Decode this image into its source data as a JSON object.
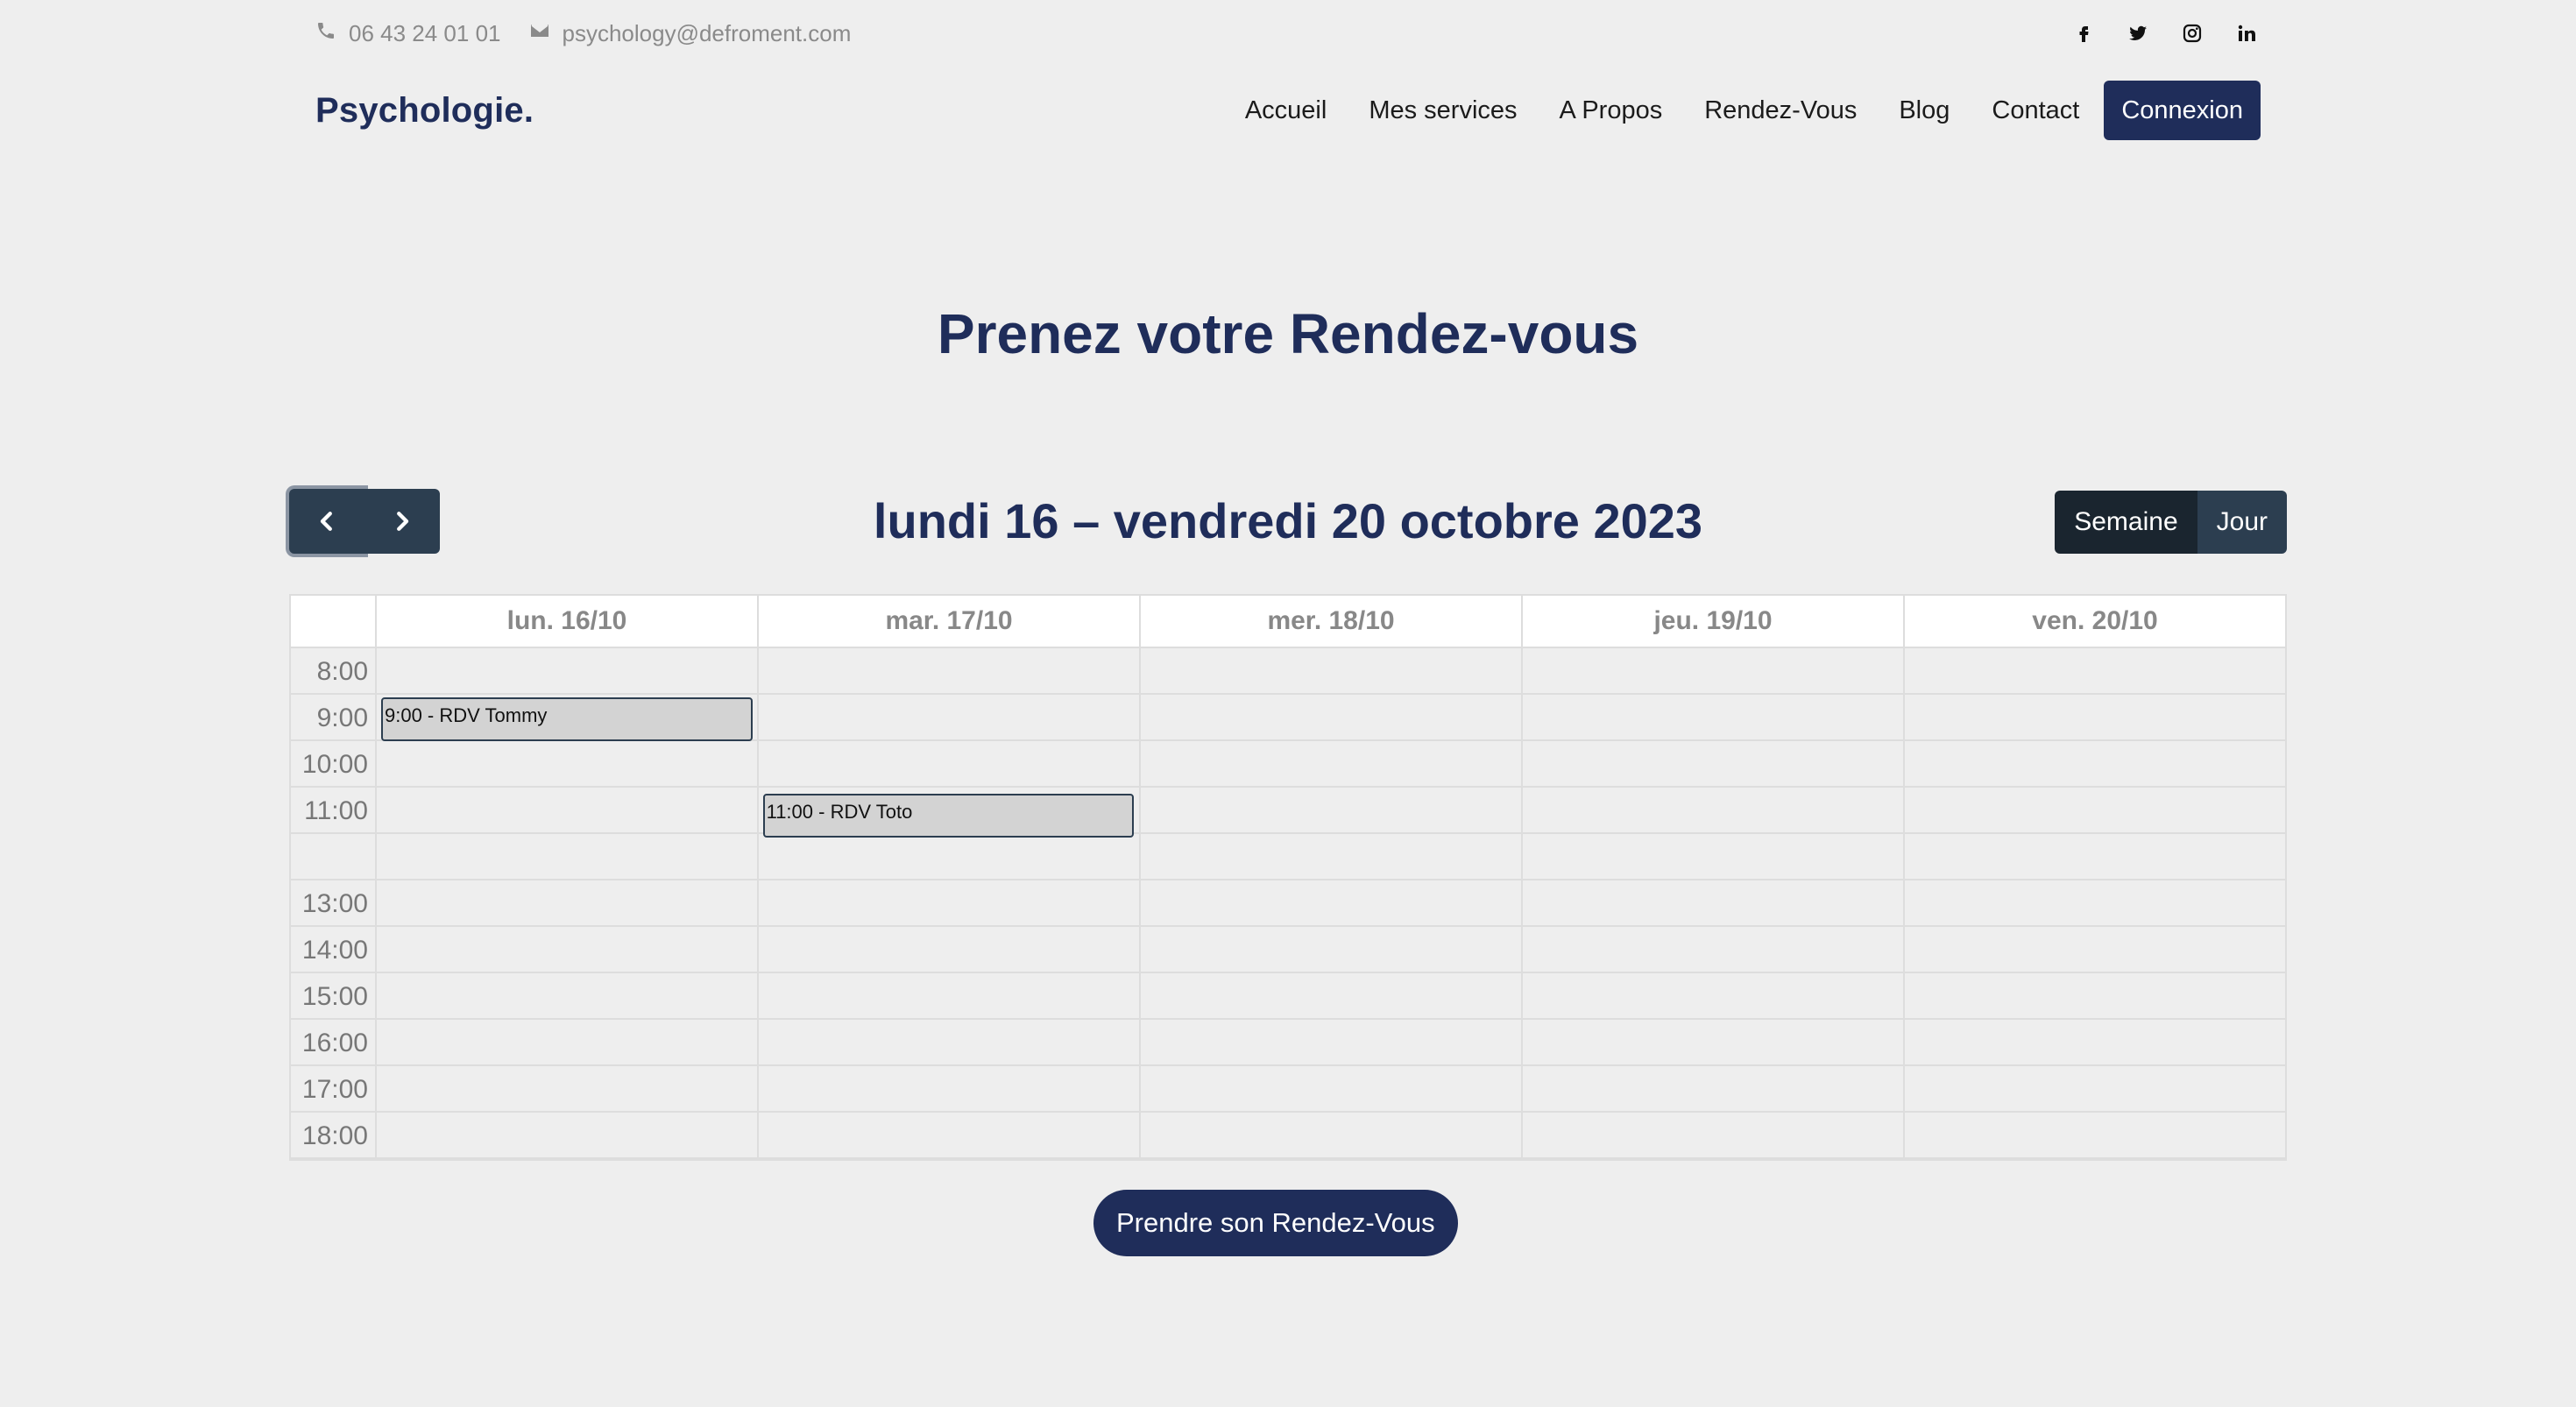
{
  "topbar": {
    "phone": "06 43 24 01 01",
    "email": "psychology@defroment.com",
    "phone_icon": "phone-icon",
    "email_icon": "envelope-icon",
    "socials": [
      "facebook-icon",
      "twitter-icon",
      "instagram-icon",
      "linkedin-icon"
    ]
  },
  "navbar": {
    "brand": "Psychologie.",
    "links": [
      "Accueil",
      "Mes services",
      "A Propos",
      "Rendez-Vous",
      "Blog",
      "Contact"
    ],
    "login": "Connexion"
  },
  "page": {
    "title": "Prenez votre Rendez-vous",
    "cta": "Prendre son Rendez-Vous"
  },
  "calendar": {
    "range_title": "lundi 16 – vendredi 20 octobre 2023",
    "views": [
      "Semaine",
      "Jour"
    ],
    "active_view": "Semaine",
    "days": [
      "lun. 16/10",
      "mar. 17/10",
      "mer. 18/10",
      "jeu. 19/10",
      "ven. 20/10"
    ],
    "times": [
      "8:00",
      "9:00",
      "10:00",
      "11:00",
      "",
      "13:00",
      "14:00",
      "15:00",
      "16:00",
      "17:00",
      "18:00"
    ],
    "events": [
      {
        "label": "9:00 - RDV Tommy",
        "day": "lun. 16/10",
        "start": "9:00"
      },
      {
        "label": "11:00 - RDV Toto",
        "day": "mar. 17/10",
        "start": "11:00"
      }
    ]
  },
  "colors": {
    "brand": "#1f2d5a",
    "button_dark": "#2c3e50",
    "background": "#eeeeee"
  }
}
